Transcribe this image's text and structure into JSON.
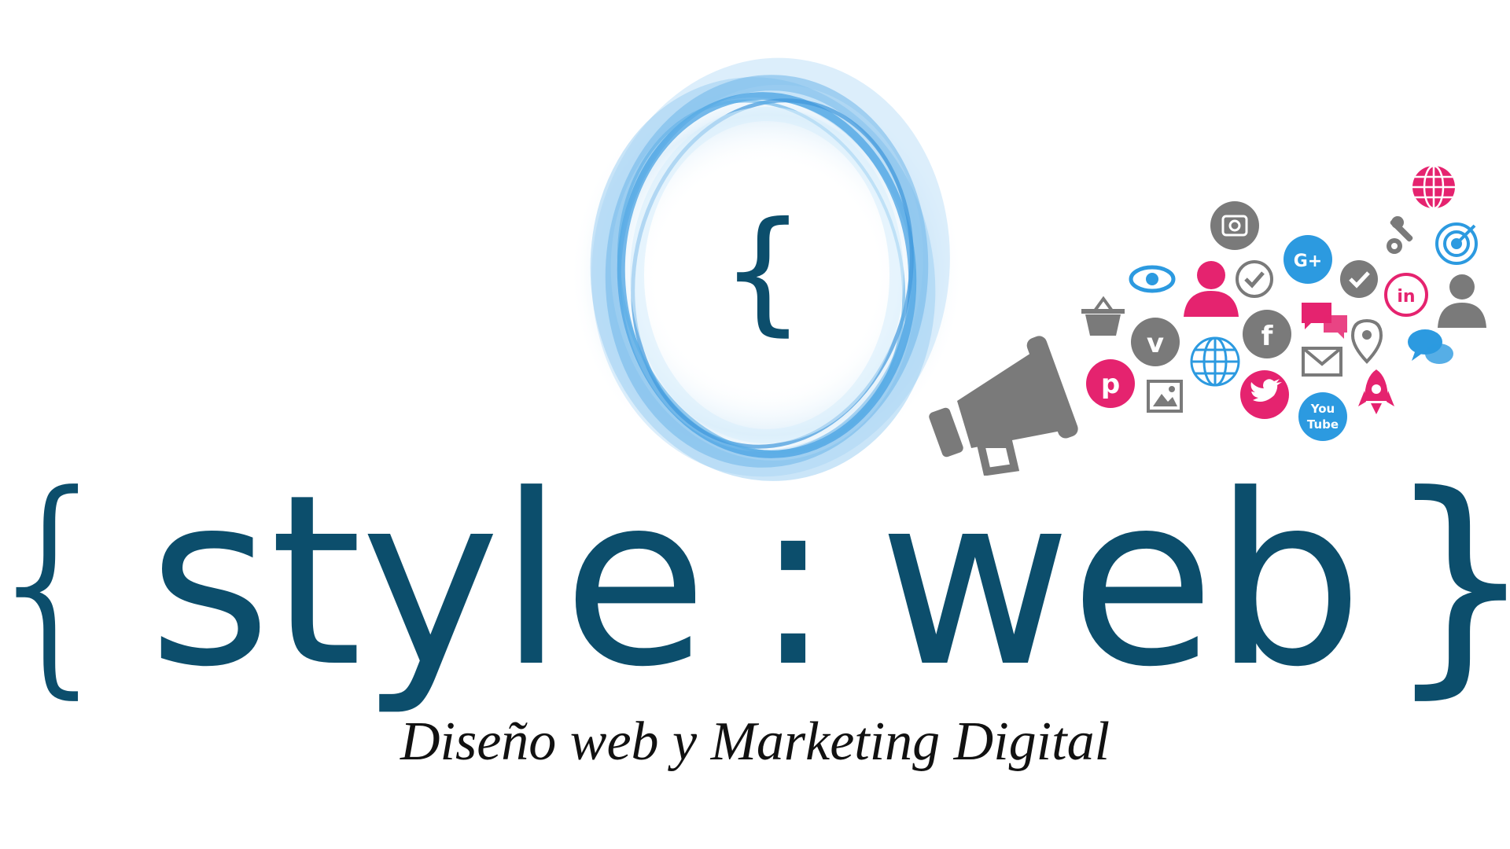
{
  "logo": {
    "ring_brace": "{",
    "wordmark": {
      "brace_open": "{",
      "word1": "style",
      "colon": ":",
      "word2": "web",
      "brace_close": "}"
    },
    "tagline": "Diseño web y Marketing Digital"
  },
  "icons": {
    "googleplus_text": "G+",
    "linkedin_text": "in",
    "facebook_text": "f",
    "youtube_text_1": "You",
    "youtube_text_2": "Tube",
    "vimeo_text": "v"
  },
  "colors": {
    "brand_dark": "#0c4e6c",
    "ring_blue": "#4aa3e3",
    "gray": "#7a7a7a",
    "pink": "#e5236f",
    "sky": "#2c9ae0"
  }
}
